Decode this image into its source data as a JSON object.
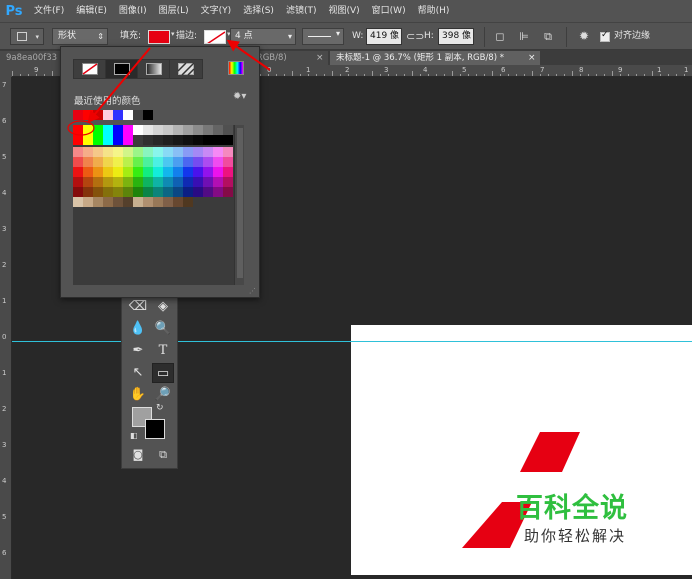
{
  "app": {
    "logo": "Ps"
  },
  "menu": [
    "文件(F)",
    "编辑(E)",
    "图像(I)",
    "图层(L)",
    "文字(Y)",
    "选择(S)",
    "滤镜(T)",
    "视图(V)",
    "窗口(W)",
    "帮助(H)"
  ],
  "options": {
    "mode": "形状",
    "fill_label": "填充:",
    "fill_color": "#e60012",
    "stroke_label": "描边:",
    "stroke_width": "4 点",
    "w_label": "W:",
    "w_value": "419 像",
    "h_label": "H:",
    "h_value": "398 像",
    "align_edges_label": "对齐边缘",
    "align_edges_checked": true
  },
  "tabs": [
    {
      "label": "9a8ea00f33",
      "active": false
    },
    {
      "label": "0, RGB/8)",
      "active": false
    },
    {
      "label": "未标题-1 @ 36.7% (矩形 1 副本, RGB/8) *",
      "active": true
    }
  ],
  "ruler_h": [
    {
      "t": "9"
    },
    {
      "t": "5"
    },
    {
      "t": "4"
    },
    {
      "t": "3"
    },
    {
      "t": "2"
    },
    {
      "t": "1"
    },
    {
      "t": "0"
    },
    {
      "t": "1"
    },
    {
      "t": "2"
    },
    {
      "t": "3"
    },
    {
      "t": "4"
    },
    {
      "t": "5"
    },
    {
      "t": "6"
    },
    {
      "t": "7"
    },
    {
      "t": "8"
    },
    {
      "t": "9"
    },
    {
      "t": "1"
    },
    {
      "t": "1"
    }
  ],
  "ruler_v": [
    "7",
    "6",
    "5",
    "4",
    "3",
    "2",
    "1",
    "0",
    "1",
    "2",
    "3",
    "4",
    "5",
    "6"
  ],
  "popup": {
    "recent_label": "最近使用的颜色",
    "recent_colors": [
      "#e60012",
      "#ff0000",
      "#cc0000",
      "#ffccdd",
      "#3030ff",
      "#ffffff",
      "#404040",
      "#000000"
    ]
  },
  "watermark": {
    "title": "百科全说",
    "subtitle": "助你轻松解决"
  },
  "colors": {
    "accent_red": "#e60012",
    "guide": "#2fc1d9",
    "watermark_green": "#2fbf3f"
  }
}
